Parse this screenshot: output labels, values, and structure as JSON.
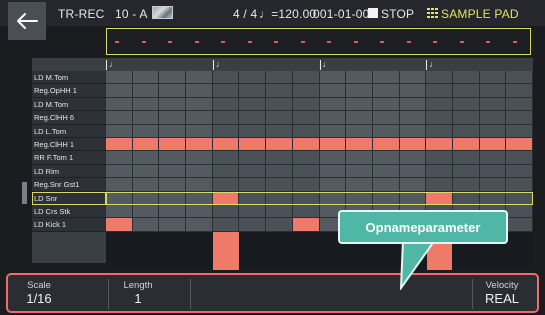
{
  "header": {
    "back_icon": "back-arrow-icon",
    "title": "TR-REC",
    "kit": "10 - A",
    "time_signature": "4 / 4",
    "tempo": "♩=120.00",
    "position": "001-01-000",
    "transport_status": "STOP",
    "pad_mode": "SAMPLE PAD"
  },
  "lanes": [
    {
      "label": "LD M.Tom",
      "steps": []
    },
    {
      "label": "Reg.OpHH 1",
      "steps": []
    },
    {
      "label": "LD M.Tom",
      "steps": []
    },
    {
      "label": "Reg.ClHH 6",
      "steps": []
    },
    {
      "label": "LD L.Tom",
      "steps": []
    },
    {
      "label": "Reg.ClHH 1",
      "steps": [
        0,
        1,
        2,
        3,
        4,
        5,
        6,
        7,
        8,
        9,
        10,
        11,
        12,
        13,
        14,
        15
      ]
    },
    {
      "label": "RR F.Tom 1",
      "steps": []
    },
    {
      "label": "LD Rim",
      "steps": []
    },
    {
      "label": "Reg.Snr Gst1",
      "steps": []
    },
    {
      "label": "LD Snr",
      "steps": [
        4,
        12
      ],
      "selected": true
    },
    {
      "label": "LD Crs Stk",
      "steps": []
    },
    {
      "label": "LD Kick 1",
      "steps": [
        0,
        7
      ]
    }
  ],
  "bar_marker": "♩",
  "velocity_steps": [
    4,
    12
  ],
  "params": {
    "scale": {
      "label": "Scale",
      "value": "1/16"
    },
    "length": {
      "label": "Length",
      "value": "1"
    },
    "velocity": {
      "label": "Velocity",
      "value": "REAL"
    }
  },
  "callout": "Opnameparameter",
  "colors": {
    "accent_red": "#f07a6a",
    "highlight_yellow": "#d9d86a",
    "callout_teal": "#4fb7a6"
  }
}
